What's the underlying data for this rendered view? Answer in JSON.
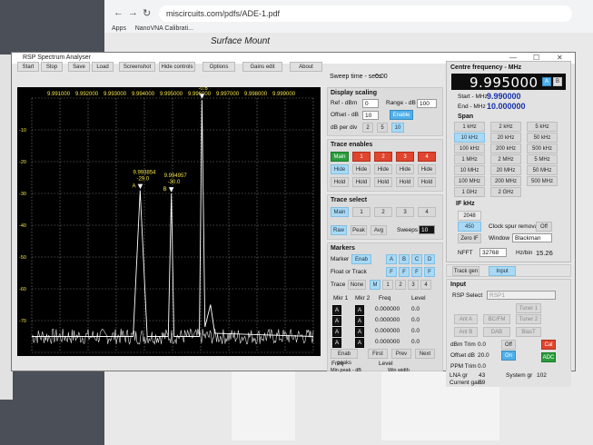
{
  "browser": {
    "url": "miscircuits.com/pdfs/ADE-1.pdf",
    "bookmarks": [
      "Apps",
      "NanoVNA Calibrati..."
    ],
    "pdf_heading": "Surface Mount"
  },
  "window": {
    "title": "RSP Spectrum Analyser",
    "buttons": [
      "—",
      "☐",
      "✕"
    ]
  },
  "toolbar": {
    "start": "Start",
    "stop": "Stop",
    "save": "Save",
    "load": "Load",
    "screenshot": "Screenshot",
    "hide_controls": "Hide controls",
    "options": "Options",
    "gains_edit": "Gains edit",
    "about": "About",
    "sweep_time_label": "Sweep time - secs",
    "sweep_time_value": "0.00"
  },
  "plot": {
    "x_ticks": [
      "9.991000",
      "9.992000",
      "9.993000",
      "9.994000",
      "9.995000",
      "9.996000",
      "9.997000",
      "9.998000",
      "9.999000"
    ],
    "y_ticks": [
      "-10",
      "-20",
      "-30",
      "-40",
      "-50",
      "-60",
      "-70"
    ],
    "markers": [
      {
        "letter": "A",
        "freq": "9.993854",
        "level": "-29.0",
        "x": 9.993854,
        "y": -29.0
      },
      {
        "letter": "B",
        "freq": "9.994957",
        "level": "-30.0",
        "x": 9.994957,
        "y": -30.0
      },
      {
        "letter": "",
        "freq": "9.996046",
        "level": "-0.6",
        "x": 9.996046,
        "y": -0.6
      }
    ],
    "noise_floor_db": -75
  },
  "chart_data": {
    "type": "line",
    "title": "",
    "xlabel": "",
    "ylabel": "",
    "xlim": [
      9.99,
      10.0
    ],
    "ylim": [
      -80,
      0
    ],
    "series": [
      {
        "values": [
          [
            9.99,
            -75
          ],
          [
            9.992,
            -75
          ],
          [
            9.9936,
            -75
          ],
          [
            9.99385,
            -29
          ],
          [
            9.9941,
            -75
          ],
          [
            9.99485,
            -75
          ],
          [
            9.994957,
            -30
          ],
          [
            9.99505,
            -75
          ],
          [
            9.99595,
            -75
          ],
          [
            9.996046,
            -0.6
          ],
          [
            9.99615,
            -72
          ],
          [
            9.99635,
            -65
          ],
          [
            9.9965,
            -74
          ],
          [
            10.0,
            -75
          ]
        ]
      }
    ]
  },
  "display_scaling": {
    "title": "Display scaling",
    "ref_label": "Ref - dBm",
    "ref_value": "0",
    "range_label": "Range - dB",
    "range_value": "100",
    "offset_label": "Offset - dB",
    "offset_value": "10",
    "enable": "Enable",
    "db_per_div_label": "dB per div",
    "db_per_div": [
      "2",
      "5",
      "10"
    ]
  },
  "trace_enables": {
    "title": "Trace enables",
    "traces": [
      "Main",
      "1",
      "2",
      "3",
      "4"
    ],
    "hide_row": [
      "Hide",
      "Hide",
      "Hide",
      "Hide",
      "Hide"
    ],
    "hold_row": [
      "Hold",
      "Hold",
      "Hold",
      "Hold",
      "Hold"
    ]
  },
  "trace_select": {
    "title": "Trace select",
    "traces": [
      "Main",
      "1",
      "2",
      "3",
      "4"
    ],
    "modes": [
      "Raw",
      "Peak",
      "Avg"
    ],
    "sweeps_label": "Sweeps",
    "sweeps_value": "10"
  },
  "markers_panel": {
    "title": "Markers",
    "marker_label": "Marker",
    "enab": "Enab",
    "letters": [
      "A",
      "B",
      "C",
      "D"
    ],
    "float_label": "Float or Track",
    "ft": [
      "F",
      "F",
      "F",
      "F"
    ],
    "trace_label": "Trace",
    "none": "None",
    "trace_opts": [
      "M",
      "1",
      "2",
      "3",
      "4"
    ],
    "col_mkr1": "Mkr 1",
    "col_mkr2": "Mkr 2",
    "col_freq": "Freq",
    "col_level": "Level",
    "rows": [
      {
        "m1": "A",
        "m2": "A",
        "freq": "0.000000",
        "level": "0.0"
      },
      {
        "m1": "A",
        "m2": "A",
        "freq": "0.000000",
        "level": "0.0"
      },
      {
        "m1": "A",
        "m2": "A",
        "freq": "0.000000",
        "level": "0.0"
      },
      {
        "m1": "A",
        "m2": "A",
        "freq": "0.000000",
        "level": "0.0"
      }
    ],
    "enab_peaks": "Enab peaks",
    "first": "First",
    "prev": "Prev",
    "next": "Next",
    "freq_label": "Freq",
    "level_label": "Level",
    "min_peak_label": "Min peak - dB",
    "win_width_label": "Win width"
  },
  "centre": {
    "title": "Centre frequency - MHz",
    "value": "9.995000",
    "a": "A",
    "b": "B",
    "start_label": "Start - MHz",
    "start_value": "9.990000",
    "end_label": "End - MHz",
    "end_value": "10.000000"
  },
  "span": {
    "title": "Span",
    "buttons": [
      [
        "1 kHz",
        "2 kHz",
        "5 kHz"
      ],
      [
        "10 kHz",
        "20 kHz",
        "50 kHz"
      ],
      [
        "100 kHz",
        "200 kHz",
        "500 kHz"
      ],
      [
        "1 MHz",
        "2 MHz",
        "5 MHz"
      ],
      [
        "10 MHz",
        "20 MHz",
        "50 MHz"
      ],
      [
        "100 MHz",
        "200 MHz",
        "500 MHz"
      ],
      [
        "1 GHz",
        "2 GHz",
        ""
      ]
    ]
  },
  "if": {
    "title": "IF kHz",
    "v1": "2048",
    "v2": "450",
    "zero_if": "Zero IF",
    "clock_spur_label": "Clock spur removal",
    "clock_spur_value": "Off",
    "window_label": "Window",
    "window_value": "Blackman",
    "nfft_label": "NFFT",
    "nfft_value": "32768",
    "hz_bin_label": "Hz/bin",
    "hz_bin_value": "15.26"
  },
  "trackgen": {
    "track_gen": "Track gen",
    "input": "Input"
  },
  "input_panel": {
    "title": "Input",
    "rsp_select_label": "RSP Select",
    "rsp_select_value": "RSP1",
    "tuner1": "Tuner 1",
    "ant_a": "Ant A",
    "bc_fm": "BC/FM",
    "tuner2": "Tuner 2",
    "ant_b": "Ant B",
    "dab": "DAB",
    "bias_t": "BiasT",
    "dbm_trim_label": "dBm Trim",
    "dbm_trim_value": "0.0",
    "off": "Off",
    "cal": "Cal",
    "offset_db_label": "Offset dB",
    "offset_db_value": "20.0",
    "on": "On",
    "adc": "ADC",
    "ppm_trim_label": "PPM Trim",
    "ppm_trim_value": "0.0",
    "lna_gr_label": "LNA gr",
    "lna_gr_value": "43",
    "system_gr_label": "System gr",
    "system_gr_value": "102",
    "current_gain_label": "Current gain",
    "current_gain_value": "59"
  }
}
